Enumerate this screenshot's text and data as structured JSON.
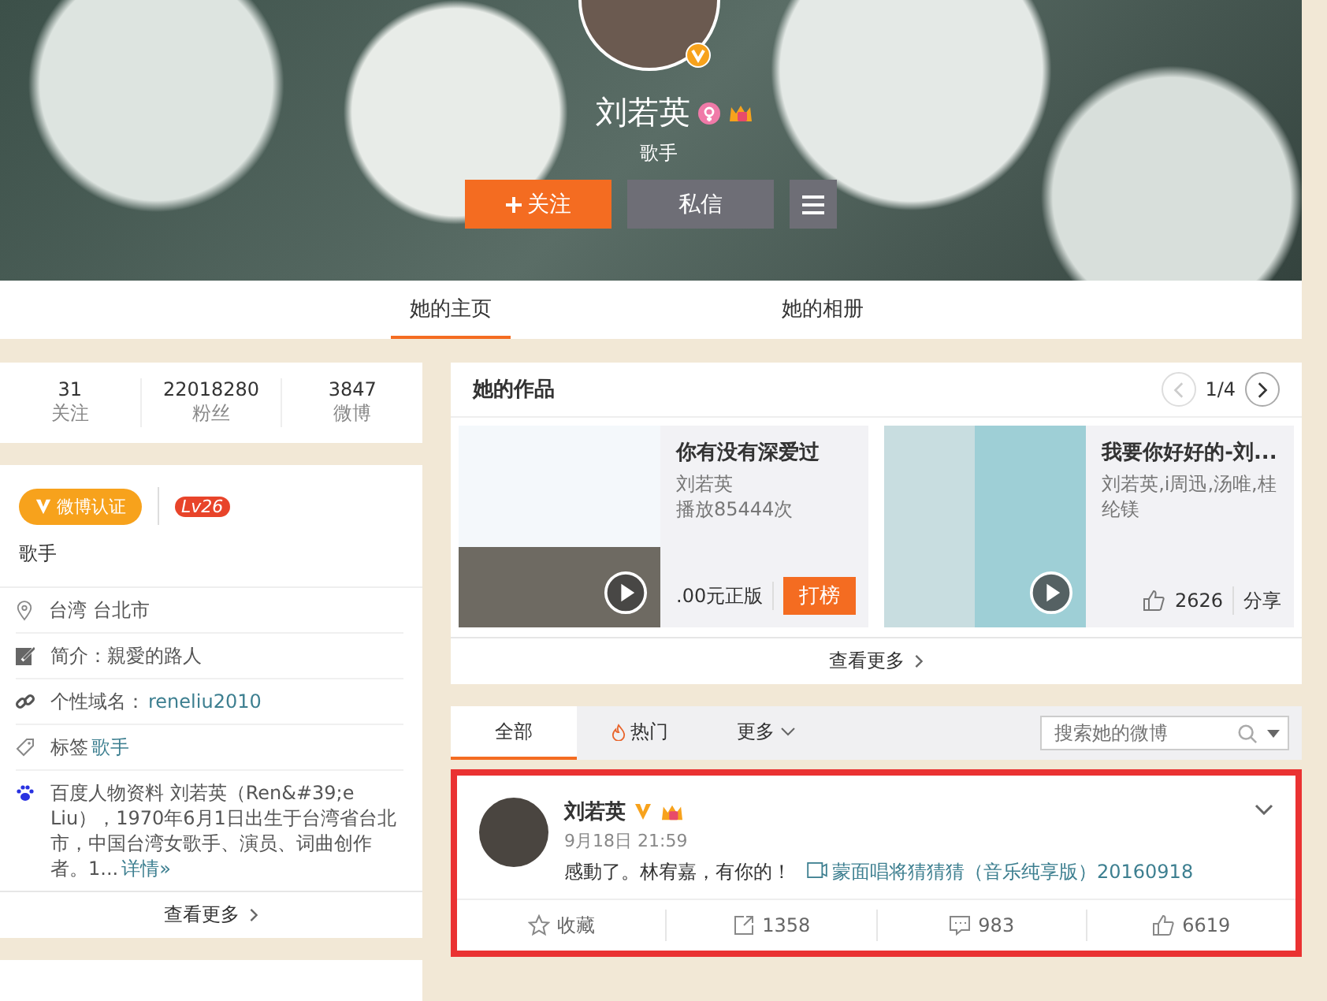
{
  "profile": {
    "name": "刘若英",
    "title": "歌手",
    "follow_button": "关注",
    "message_button": "私信"
  },
  "tabs": [
    {
      "label": "她的主页",
      "selected": true
    },
    {
      "label": "她的相册",
      "selected": false
    }
  ],
  "stats": [
    {
      "value": "31",
      "label": "关注"
    },
    {
      "value": "22018280",
      "label": "粉丝"
    },
    {
      "value": "3847",
      "label": "微博"
    }
  ],
  "verification": {
    "badge": "微博认证",
    "level": "Lv26",
    "description": "歌手"
  },
  "details": [
    {
      "kind": "location",
      "text": "台湾 台北市"
    },
    {
      "kind": "bio",
      "text": "简介：親愛的路人"
    },
    {
      "kind": "link",
      "text": "个性域名：",
      "link": "reneliu2010"
    },
    {
      "kind": "tag",
      "text": "标签",
      "link": "歌手"
    },
    {
      "kind": "baidu",
      "text": "百度人物资料 刘若英（Ren&#39;e Liu），1970年6月1日出生于台湾省台北市，中国台湾女歌手、演员、词曲创作者。1...",
      "link": "详情»"
    }
  ],
  "info_more": "查看更多",
  "works": {
    "title": "她的作品",
    "pager": {
      "text": "1/4",
      "prev_disabled": true
    },
    "more": "查看更多",
    "items": [
      {
        "kind": "chart",
        "title": "你有没有深爱过",
        "artist": "刘若英",
        "plays": "播放85444次",
        "price": ".00元正版",
        "action": "打榜"
      },
      {
        "kind": "share",
        "title": "我要你好好的-刘...",
        "artist": "刘若英,i周迅,汤唯,桂纶镁",
        "likes": "2626",
        "action": "分享"
      }
    ]
  },
  "feed_tabs": [
    {
      "kind": "plain",
      "label": "全部",
      "selected": true
    },
    {
      "kind": "hot",
      "label": "热门",
      "selected": false
    },
    {
      "kind": "menu",
      "label": "更多",
      "selected": false
    }
  ],
  "search": {
    "placeholder": "搜索她的微博"
  },
  "post": {
    "highlighted": true,
    "author": "刘若英",
    "time": "9月18日 21:59",
    "text": "感動了。林宥嘉，有你的！",
    "link": "蒙面唱将猜猜猜（音乐纯享版）20160918",
    "actions": [
      {
        "kind": "favorite",
        "label": "收藏"
      },
      {
        "kind": "repost",
        "label": "1358"
      },
      {
        "kind": "comment",
        "label": "983"
      },
      {
        "kind": "like",
        "label": "6619"
      }
    ]
  }
}
